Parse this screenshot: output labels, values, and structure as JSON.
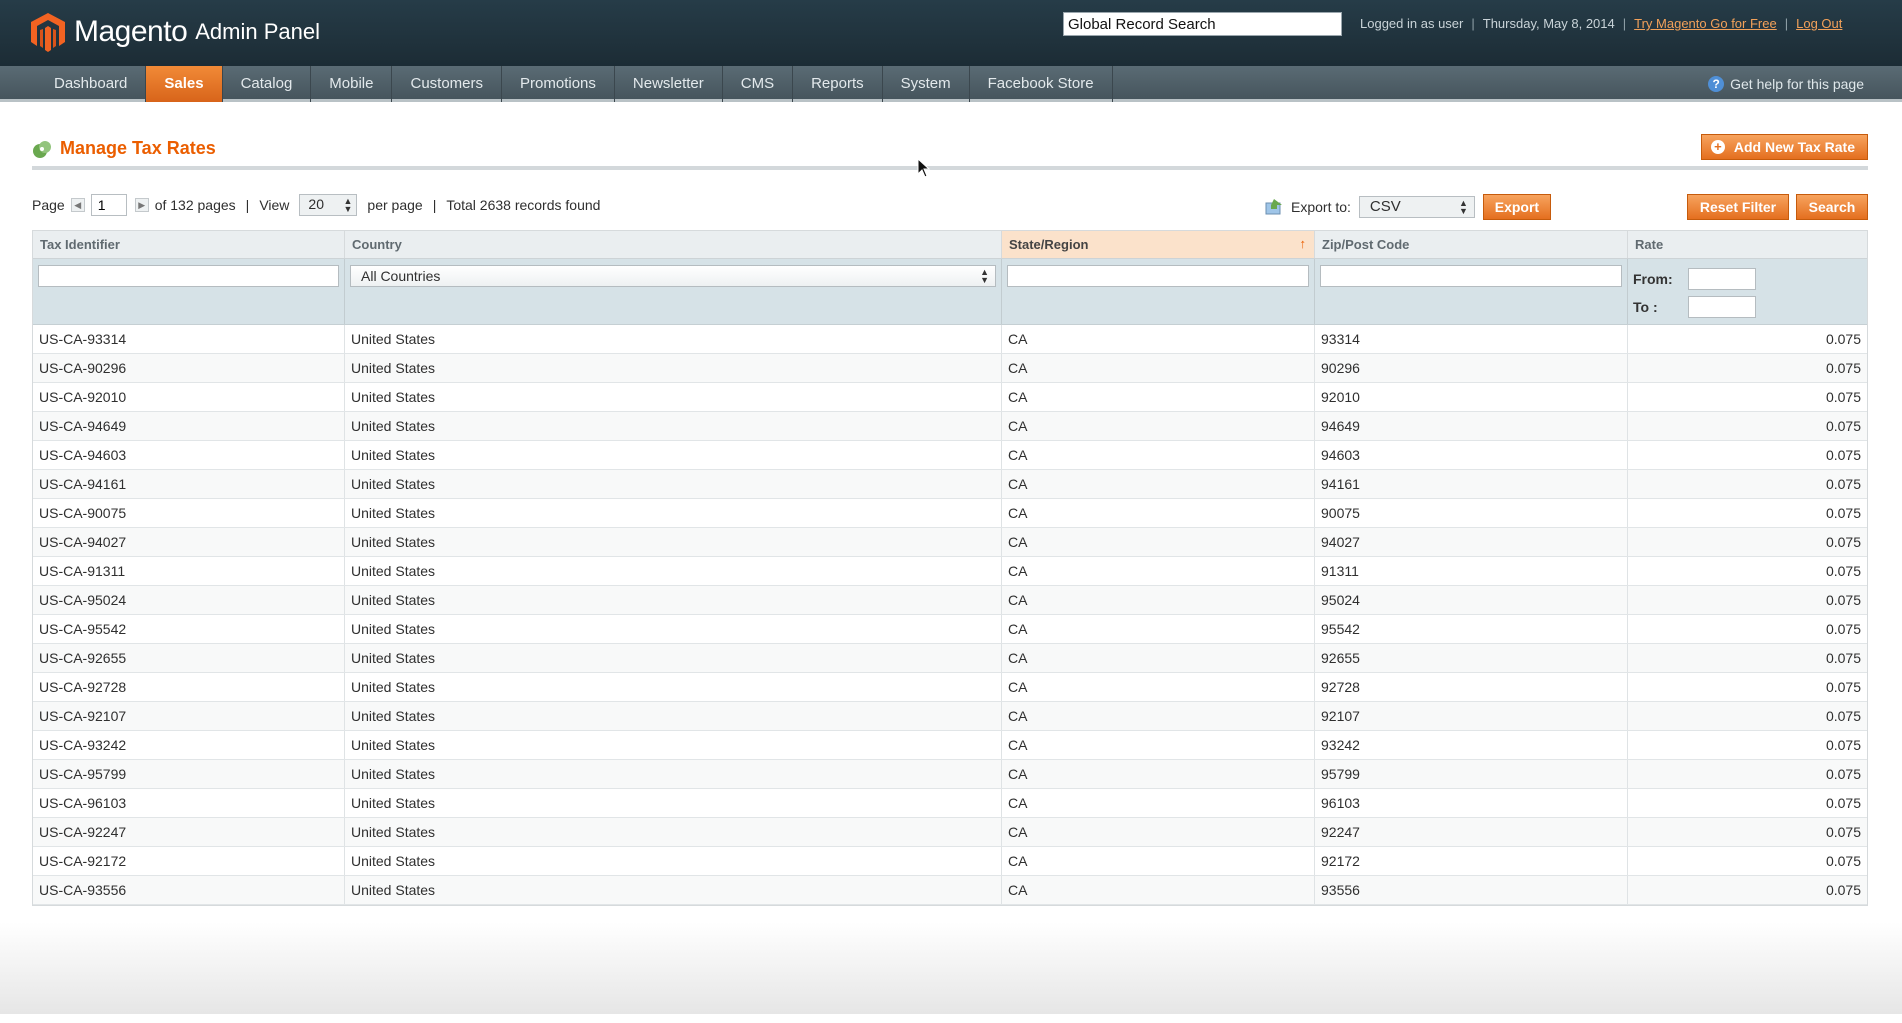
{
  "header": {
    "brand": "Magento",
    "brand_sub": "Admin Panel",
    "global_search_value": "Global Record Search",
    "logged_in": "Logged in as user",
    "date": "Thursday, May 8, 2014",
    "try_link": "Try Magento Go for Free",
    "logout": "Log Out"
  },
  "nav": {
    "items": [
      "Dashboard",
      "Sales",
      "Catalog",
      "Mobile",
      "Customers",
      "Promotions",
      "Newsletter",
      "CMS",
      "Reports",
      "System",
      "Facebook Store"
    ],
    "active": "Sales",
    "help": "Get help for this page"
  },
  "page": {
    "title": "Manage Tax Rates",
    "add_button": "Add New Tax Rate"
  },
  "pager": {
    "page_label": "Page",
    "page_value": "1",
    "of_pages": "of 132 pages",
    "view_label": "View",
    "per_page_value": "20",
    "per_page_label": "per page",
    "total": "Total 2638 records found"
  },
  "export": {
    "label": "Export to:",
    "format": "CSV",
    "button": "Export"
  },
  "actions": {
    "reset_filter": "Reset Filter",
    "search": "Search"
  },
  "grid": {
    "columns": [
      "Tax Identifier",
      "Country",
      "State/Region",
      "Zip/Post Code",
      "Rate"
    ],
    "sorted_column": "State/Region",
    "filter": {
      "country": "All Countries",
      "rate_from": "From:",
      "rate_to": "To :"
    },
    "rows": [
      [
        "US-CA-93314",
        "United States",
        "CA",
        "93314",
        "0.075"
      ],
      [
        "US-CA-90296",
        "United States",
        "CA",
        "90296",
        "0.075"
      ],
      [
        "US-CA-92010",
        "United States",
        "CA",
        "92010",
        "0.075"
      ],
      [
        "US-CA-94649",
        "United States",
        "CA",
        "94649",
        "0.075"
      ],
      [
        "US-CA-94603",
        "United States",
        "CA",
        "94603",
        "0.075"
      ],
      [
        "US-CA-94161",
        "United States",
        "CA",
        "94161",
        "0.075"
      ],
      [
        "US-CA-90075",
        "United States",
        "CA",
        "90075",
        "0.075"
      ],
      [
        "US-CA-94027",
        "United States",
        "CA",
        "94027",
        "0.075"
      ],
      [
        "US-CA-91311",
        "United States",
        "CA",
        "91311",
        "0.075"
      ],
      [
        "US-CA-95024",
        "United States",
        "CA",
        "95024",
        "0.075"
      ],
      [
        "US-CA-95542",
        "United States",
        "CA",
        "95542",
        "0.075"
      ],
      [
        "US-CA-92655",
        "United States",
        "CA",
        "92655",
        "0.075"
      ],
      [
        "US-CA-92728",
        "United States",
        "CA",
        "92728",
        "0.075"
      ],
      [
        "US-CA-92107",
        "United States",
        "CA",
        "92107",
        "0.075"
      ],
      [
        "US-CA-93242",
        "United States",
        "CA",
        "93242",
        "0.075"
      ],
      [
        "US-CA-95799",
        "United States",
        "CA",
        "95799",
        "0.075"
      ],
      [
        "US-CA-96103",
        "United States",
        "CA",
        "96103",
        "0.075"
      ],
      [
        "US-CA-92247",
        "United States",
        "CA",
        "92247",
        "0.075"
      ],
      [
        "US-CA-92172",
        "United States",
        "CA",
        "92172",
        "0.075"
      ],
      [
        "US-CA-93556",
        "United States",
        "CA",
        "93556",
        "0.075"
      ]
    ]
  },
  "colors": {
    "accent": "#eb5e00",
    "header_bg": "#1c2c35",
    "nav_bg": "#4f5f68",
    "filter_bg": "#d6e2e7"
  }
}
